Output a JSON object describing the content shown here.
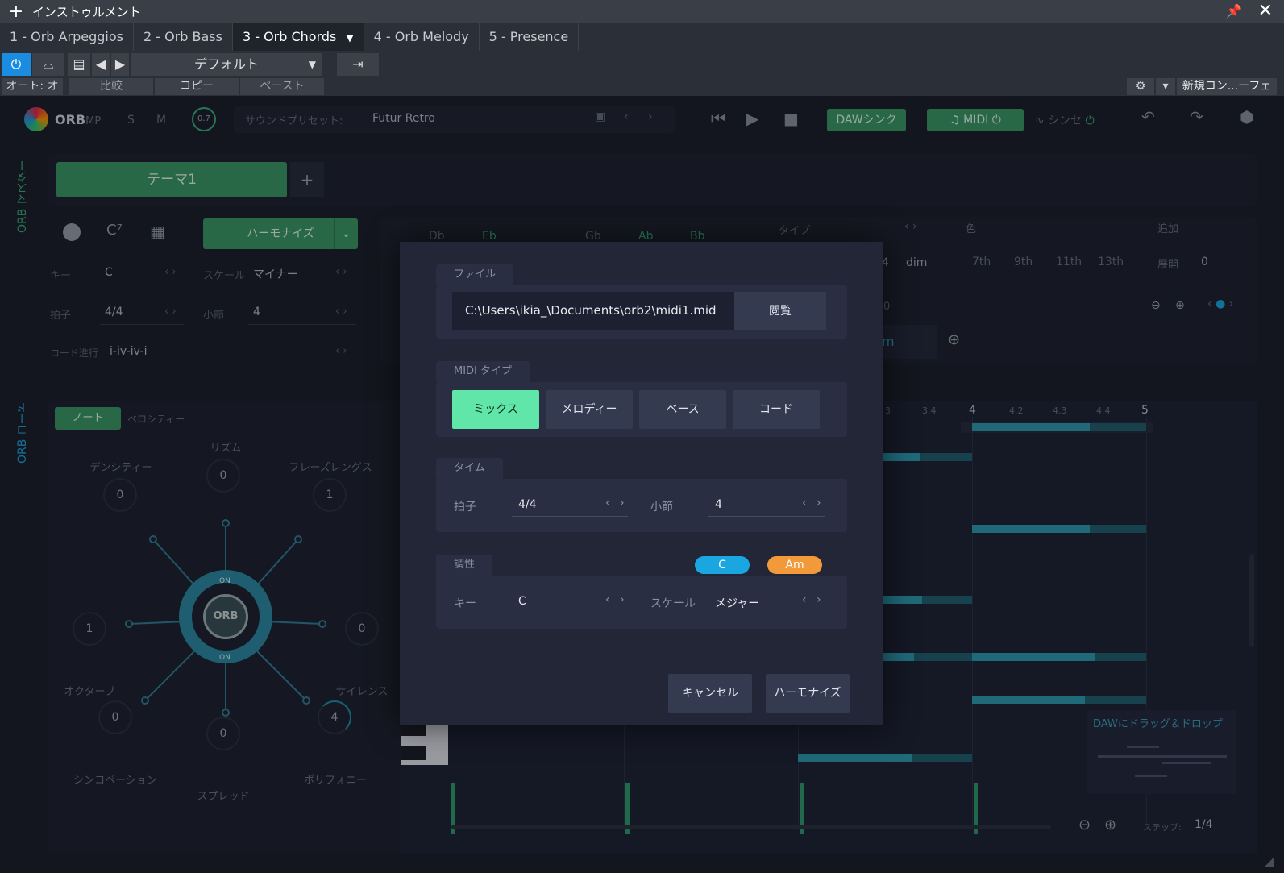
{
  "window": {
    "title": "インストゥルメント"
  },
  "tabs": [
    {
      "label": "1 - Orb Arpeggios"
    },
    {
      "label": "2 - Orb Bass"
    },
    {
      "label": "3 - Orb Chords"
    },
    {
      "label": "4 - Orb Melody"
    },
    {
      "label": "5 - Presence"
    }
  ],
  "toolbar": {
    "preset": "デフォルト",
    "auto": "オート: オフ",
    "compare": "比較",
    "copy": "コピー",
    "paste": "ペースト",
    "new_console": "新規コン...ーフェス"
  },
  "plugin": {
    "logo": "ORB",
    "logo_suffix": "MP",
    "s": "S",
    "m": "M",
    "knob_value": "0.7",
    "sound_preset_label": "サウンドプリセット:",
    "sound_preset": "Futur Retro",
    "daw_sync": "DAWシンク",
    "midi": "MIDI",
    "synth": "シンセ",
    "side_master": "ORB マスター",
    "side_code": "ORB コード",
    "theme": "テーマ1",
    "harmonize": "ハーモナイズ",
    "key_label": "キー",
    "key": "C",
    "scale_label": "スケール",
    "scale": "マイナー",
    "time_label": "拍子",
    "time": "4/4",
    "bars_label": "小節",
    "bars": "4",
    "progression_label": "コード進行",
    "progression": "i-iv-iv-i",
    "chords_top": [
      "Db",
      "Eb",
      "Gb",
      "Ab",
      "Bb"
    ],
    "type_label": "タイプ",
    "color_label": "色",
    "add_label": "追加",
    "dim": "dim",
    "four": "4",
    "zero_a": "0",
    "extensions": [
      "7th",
      "9th",
      "11th",
      "13th"
    ],
    "expand_label": "展開",
    "expand": "0",
    "chord_tail": "m",
    "note_tab": "ノート",
    "velocity_tab": "ベロシティー",
    "orb_center": "ORB",
    "on_top": "ON",
    "on_bottom": "ON",
    "knobs": [
      {
        "label": "デンシティー",
        "value": "0"
      },
      {
        "label": "リズム",
        "value": "0"
      },
      {
        "label": "フレーズレングス",
        "value": "1"
      },
      {
        "label": "オクターブ",
        "value": "1"
      },
      {
        "label": "サイレンス",
        "value": "0"
      },
      {
        "label": "シンコペーション",
        "value": "0"
      },
      {
        "label": "スプレッド",
        "value": "0"
      },
      {
        "label": "ポリフォニー",
        "value": "4"
      }
    ],
    "ruler": [
      "3",
      "3.4",
      "4",
      "4.2",
      "4.3",
      "4.4",
      "5"
    ],
    "drag_drop": "DAWにドラッグ＆ドロップ",
    "step_label": "ステップ:",
    "step": "1/4"
  },
  "dialog": {
    "file_tab": "ファイル",
    "file_path": "C:\\Users\\ikia_\\Documents\\orb2\\midi1.mid",
    "browse": "閲覧",
    "midi_type_tab": "MIDI タイプ",
    "midi_types": [
      "ミックス",
      "メロディー",
      "ベース",
      "コード"
    ],
    "time_tab": "タイム",
    "time_label": "拍子",
    "time": "4/4",
    "bars_label": "小節",
    "bars": "4",
    "tonality_tab": "調性",
    "badge_c": "C",
    "badge_am": "Am",
    "key_label": "キー",
    "key": "C",
    "scale_label": "スケール",
    "scale": "メジャー",
    "cancel": "キャンセル",
    "harmonize": "ハーモナイズ"
  },
  "colors": {
    "accent_green": "#3a9a64",
    "mint": "#60e6a8",
    "cyan": "#1aa6e0",
    "orange": "#f29a3a"
  }
}
